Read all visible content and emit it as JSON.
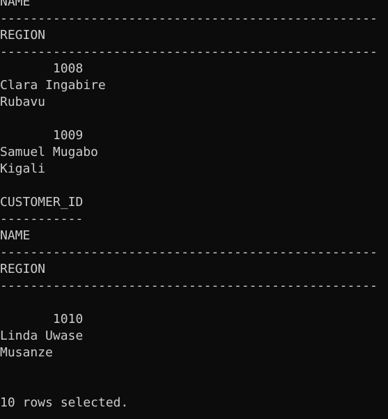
{
  "terminal": {
    "background": "#0c0c0c",
    "foreground": "#cccccc",
    "lines": [
      "NAME",
      "--------------------------------------------------",
      "REGION",
      "--------------------------------------------------",
      "       1008",
      "Clara Ingabire",
      "Rubavu",
      "",
      "       1009",
      "Samuel Mugabo",
      "Kigali",
      "",
      "CUSTOMER_ID",
      "-----------",
      "NAME",
      "--------------------------------------------------",
      "REGION",
      "--------------------------------------------------",
      "",
      "       1010",
      "Linda Uwase",
      "Musanze",
      "",
      "",
      "10 rows selected."
    ]
  }
}
